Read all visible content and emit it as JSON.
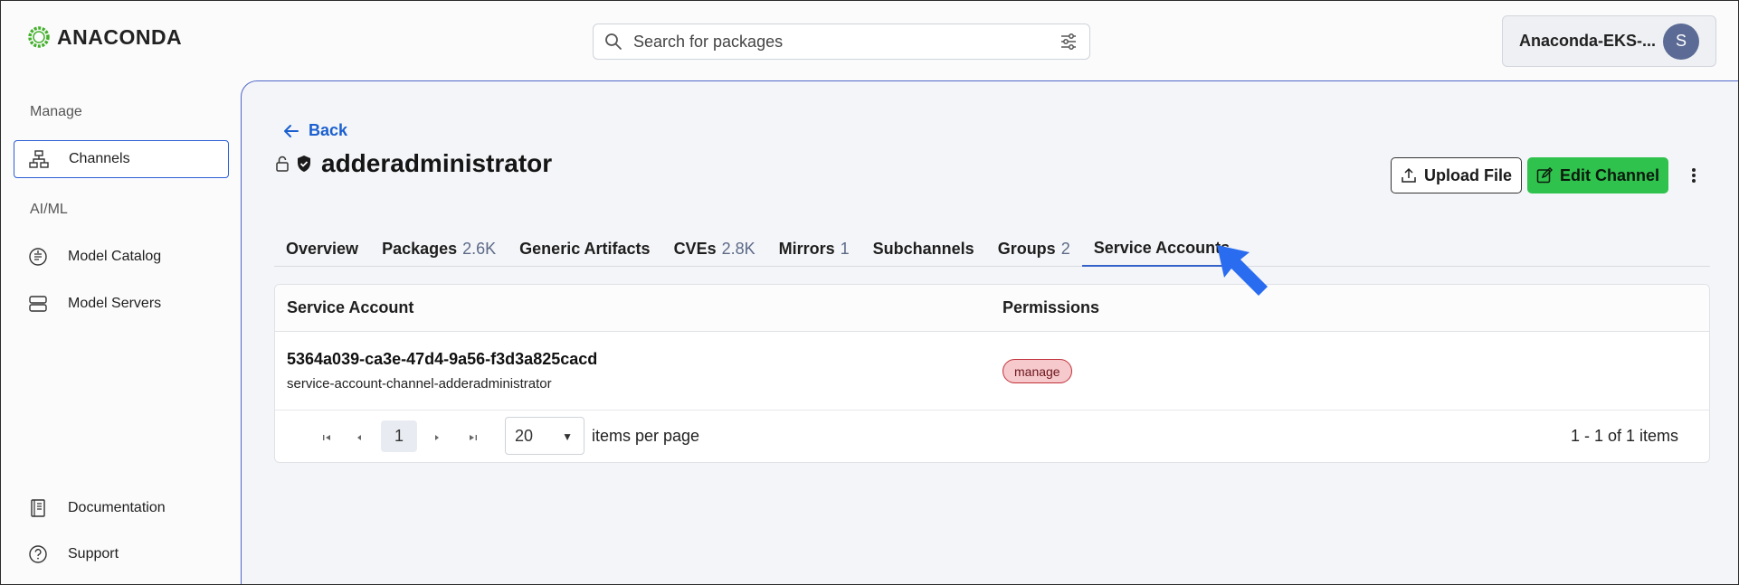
{
  "header": {
    "logo_text": "ANACONDA",
    "search_placeholder": "Search for packages",
    "account_name": "Anaconda-EKS-...",
    "avatar_initial": "S"
  },
  "sidebar": {
    "section_manage": "Manage",
    "section_aiml": "AI/ML",
    "items": [
      {
        "label": "Channels",
        "icon": "channels-icon",
        "active": true
      },
      {
        "label": "Model Catalog",
        "icon": "model-catalog-icon"
      },
      {
        "label": "Model Servers",
        "icon": "model-servers-icon"
      },
      {
        "label": "Documentation",
        "icon": "documentation-icon"
      },
      {
        "label": "Support",
        "icon": "support-icon"
      }
    ]
  },
  "page": {
    "back_label": "Back",
    "title": "adderadministrator",
    "upload_label": "Upload File",
    "edit_label": "Edit Channel"
  },
  "tabs": [
    {
      "label": "Overview",
      "count": ""
    },
    {
      "label": "Packages",
      "count": "2.6K"
    },
    {
      "label": "Generic Artifacts",
      "count": ""
    },
    {
      "label": "CVEs",
      "count": "2.8K"
    },
    {
      "label": "Mirrors",
      "count": "1"
    },
    {
      "label": "Subchannels",
      "count": ""
    },
    {
      "label": "Groups",
      "count": "2"
    },
    {
      "label": "Service Accounts",
      "count": "",
      "active": true
    }
  ],
  "table": {
    "col_account": "Service Account",
    "col_permissions": "Permissions",
    "rows": [
      {
        "id": "5364a039-ca3e-47d4-9a56-f3d3a825cacd",
        "name": "service-account-channel-adderadministrator",
        "permission": "manage"
      }
    ]
  },
  "pagination": {
    "current_page": "1",
    "page_size": "20",
    "items_per_page_label": "items per page",
    "info": "1 - 1 of 1 items"
  },
  "colors": {
    "accent": "#1a5fd0",
    "edit_button": "#2fc24d",
    "badge_bg": "#f6c9cc",
    "badge_border": "#c0313a",
    "arrow": "#2a6cf0"
  }
}
